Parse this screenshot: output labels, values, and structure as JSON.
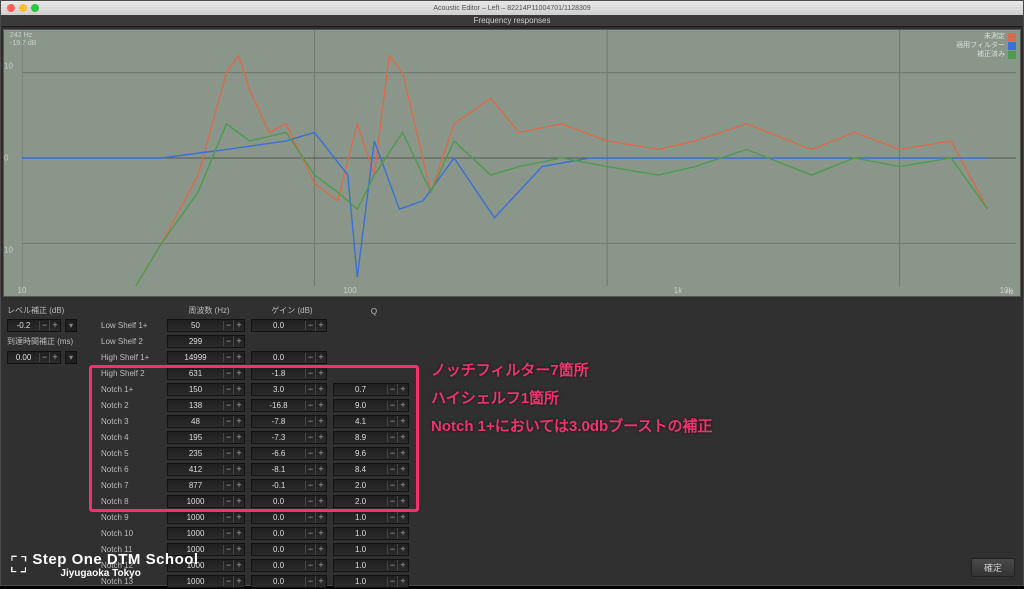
{
  "window": {
    "title": "Acoustic Editor – Left – 82214P11004701/1128309",
    "subtitle": "Frequency responses"
  },
  "cursor": {
    "freq": "242 Hz",
    "db": "-19.7 dB"
  },
  "legend": [
    {
      "label": "未測定",
      "color": "#d86b4c"
    },
    {
      "label": "適用フィルター",
      "color": "#3b6fd6"
    },
    {
      "label": "補正済み",
      "color": "#4f9a4f"
    }
  ],
  "axes": {
    "y": [
      {
        "v": "10",
        "p": 14
      },
      {
        "v": "0",
        "p": 50
      },
      {
        "v": "10",
        "p": 86
      }
    ],
    "x": [
      {
        "v": "10",
        "p": 0
      },
      {
        "v": "100",
        "p": 33
      },
      {
        "v": "1k",
        "p": 66
      },
      {
        "v": "10k",
        "p": 99
      }
    ],
    "x_unit": "Hz"
  },
  "headers": {
    "level": "レベル補正 (dB)",
    "delay": "到達時間補正 (ms)",
    "freq": "周波数 (Hz)",
    "gain": "ゲイン (dB)",
    "q": "Q"
  },
  "globals": {
    "level_value": "-0.2",
    "delay_value": "0.00"
  },
  "filters": [
    {
      "name": "Low Shelf 1+",
      "freq": "50",
      "gain": "0.0",
      "q": null,
      "hl": false
    },
    {
      "name": "Low Shelf 2",
      "freq": "299",
      "gain": null,
      "q": null,
      "hl": false
    },
    {
      "name": "High Shelf 1+",
      "freq": "14999",
      "gain": "0.0",
      "q": null,
      "hl": true
    },
    {
      "name": "High Shelf 2",
      "freq": "631",
      "gain": "-1.8",
      "q": null,
      "hl": true
    },
    {
      "name": "Notch 1+",
      "freq": "150",
      "gain": "3.0",
      "q": "0.7",
      "hl": true
    },
    {
      "name": "Notch 2",
      "freq": "138",
      "gain": "-16.8",
      "q": "9.0",
      "hl": true
    },
    {
      "name": "Notch 3",
      "freq": "48",
      "gain": "-7.8",
      "q": "4.1",
      "hl": true
    },
    {
      "name": "Notch 4",
      "freq": "195",
      "gain": "-7.3",
      "q": "8.9",
      "hl": true
    },
    {
      "name": "Notch 5",
      "freq": "235",
      "gain": "-6.6",
      "q": "9.6",
      "hl": true
    },
    {
      "name": "Notch 6",
      "freq": "412",
      "gain": "-8.1",
      "q": "8.4",
      "hl": true
    },
    {
      "name": "Notch 7",
      "freq": "877",
      "gain": "-0.1",
      "q": "2.0",
      "hl": true
    },
    {
      "name": "Notch 8",
      "freq": "1000",
      "gain": "0.0",
      "q": "2.0",
      "hl": false
    },
    {
      "name": "Notch 9",
      "freq": "1000",
      "gain": "0.0",
      "q": "1.0",
      "hl": false
    },
    {
      "name": "Notch 10",
      "freq": "1000",
      "gain": "0.0",
      "q": "1.0",
      "hl": false
    },
    {
      "name": "Notch 11",
      "freq": "1000",
      "gain": "0.0",
      "q": "1.0",
      "hl": false
    },
    {
      "name": "Notch 12",
      "freq": "1000",
      "gain": "0.0",
      "q": "1.0",
      "hl": false
    },
    {
      "name": "Notch 13",
      "freq": "1000",
      "gain": "0.0",
      "q": "1.0",
      "hl": false
    }
  ],
  "annotation": {
    "line1": "ノッチフィルター7箇所",
    "line2": "ハイシェルフ1箇所",
    "line3": "Notch 1+においては3.0dbブーストの補正"
  },
  "logo": {
    "line1": "Step One DTM School",
    "line2": "Jiyugaoka Tokyo"
  },
  "confirm": "確定",
  "chart_data": {
    "type": "line",
    "xscale": "log",
    "xlabel": "Hz",
    "ylabel": "dB",
    "ylim": [
      -15,
      15
    ],
    "xticks": [
      10,
      100,
      1000,
      10000
    ],
    "series": [
      {
        "name": "未測定",
        "color": "#d86b4c",
        "x": [
          20,
          30,
          40,
          50,
          55,
          60,
          70,
          80,
          100,
          120,
          140,
          160,
          180,
          200,
          250,
          300,
          400,
          500,
          700,
          1000,
          1500,
          2000,
          3000,
          5000,
          7000,
          10000,
          15000,
          20000
        ],
        "y": [
          -20,
          -10,
          -2,
          10,
          12,
          8,
          3,
          4,
          -3,
          -5,
          4,
          -2,
          12,
          10,
          -4,
          4,
          7,
          3,
          4,
          2,
          1,
          2,
          4,
          1,
          3,
          1,
          2,
          -6
        ]
      },
      {
        "name": "適用フィルター",
        "color": "#3b6fd6",
        "x": [
          10,
          30,
          50,
          80,
          100,
          130,
          140,
          160,
          195,
          235,
          300,
          412,
          600,
          877,
          1500,
          5000,
          14999,
          20000
        ],
        "y": [
          0,
          0,
          1,
          2,
          3,
          -2,
          -14,
          2,
          -6,
          -5,
          0,
          -7,
          -1,
          0,
          0,
          0,
          0,
          0
        ]
      },
      {
        "name": "補正済み",
        "color": "#4f9a4f",
        "x": [
          20,
          30,
          40,
          50,
          60,
          80,
          100,
          120,
          140,
          160,
          200,
          250,
          300,
          400,
          500,
          700,
          1000,
          1500,
          2000,
          3000,
          5000,
          7000,
          10000,
          15000,
          20000
        ],
        "y": [
          -20,
          -10,
          -4,
          4,
          2,
          3,
          -2,
          -4,
          -6,
          -2,
          3,
          -4,
          2,
          -2,
          -1,
          0,
          -1,
          -2,
          -1,
          1,
          -2,
          0,
          -1,
          0,
          -6
        ]
      }
    ]
  }
}
